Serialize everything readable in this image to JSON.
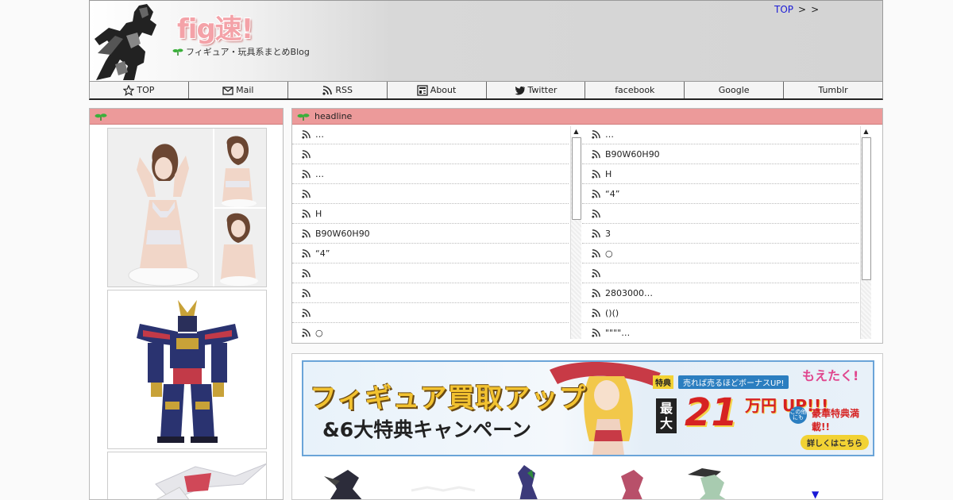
{
  "header": {
    "site_title": "fig速!",
    "tagline": "フィギュア・玩具系まとめBlog",
    "breadcrumb": {
      "top": "TOP",
      "sep1": ">",
      "sep2": ">"
    }
  },
  "nav": [
    {
      "label": "TOP",
      "icon": "star-icon"
    },
    {
      "label": "Mail",
      "icon": "mail-icon"
    },
    {
      "label": "RSS",
      "icon": "rss-icon"
    },
    {
      "label": "About",
      "icon": "about-icon"
    },
    {
      "label": "Twitter",
      "icon": "twitter-icon"
    },
    {
      "label": "facebook",
      "icon": ""
    },
    {
      "label": "Google",
      "icon": ""
    },
    {
      "label": "Tumblr",
      "icon": ""
    }
  ],
  "sidebar": {
    "title": ""
  },
  "headline": {
    "title": "headline",
    "left": [
      "…",
      "",
      "…",
      "",
      "H",
      "B90W60H90",
      "“4”",
      "",
      "",
      "",
      "○"
    ],
    "right": [
      "…",
      "B90W60H90",
      "H",
      "“4”",
      "",
      "3",
      "○",
      "",
      "2803000…",
      "()()",
      "\"\"\"\"…"
    ]
  },
  "ad": {
    "title": "フィギュア買取アップ",
    "subtitle": "&6大特典キャンペーン",
    "toku": "特典",
    "bonus": "売れば売るほどボーナスUP!",
    "max": "最大",
    "number": "21",
    "up": "万円 UP!!!",
    "brand": "もえたく!",
    "kono": "この他にも",
    "tokuten": "豪華特典満載!!",
    "detail": "詳しくはこちら"
  },
  "colors": {
    "panel_head": "#ec9a9a",
    "link": "#1a1ad6",
    "banner_border": "#6aa4d8"
  }
}
